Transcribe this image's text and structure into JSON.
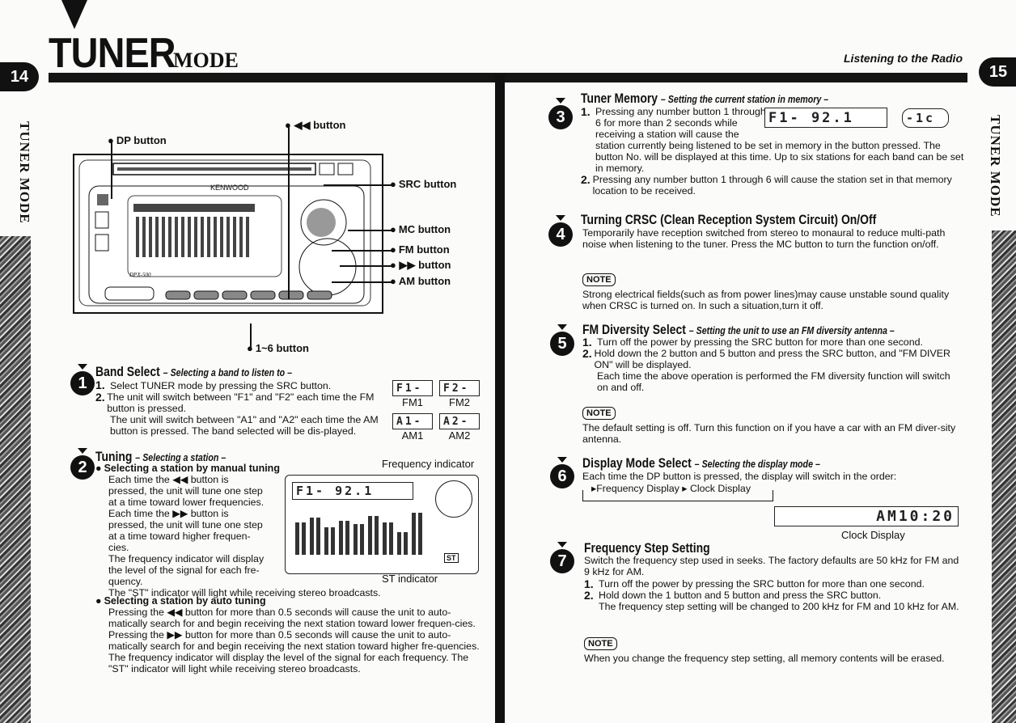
{
  "header": {
    "title_main": "TUNER",
    "title_sub": "MODE",
    "left_page": "14",
    "right_page": "15",
    "section": "Listening to the Radio",
    "side_label": "TUNER MODE"
  },
  "diagram": {
    "brand": "KENWOOD",
    "model": "DPX-500",
    "labels": {
      "dp": "DP button",
      "prev": "button",
      "src": "SRC button",
      "mc": "MC button",
      "fm": "FM button",
      "next": "button",
      "am": "AM button",
      "presets": "1~6 button"
    }
  },
  "sections": [
    {
      "num": "1",
      "title": "Band Select",
      "subtitle": "– Selecting a band to listen to –",
      "steps": [
        "Select TUNER mode by pressing the SRC button.",
        "The unit will switch between \"F1\" and \"F2\" each time the FM button is pressed."
      ],
      "extra": [
        "The unit will switch between \"A1\" and \"A2\" each time the AM button is pressed. The band selected will be dis-played."
      ],
      "displays": [
        {
          "lcd": "F1-",
          "cap": "FM1"
        },
        {
          "lcd": "F2-",
          "cap": "FM2"
        },
        {
          "lcd": "A1-",
          "cap": "AM1"
        },
        {
          "lcd": "A2-",
          "cap": "AM2"
        }
      ]
    },
    {
      "num": "2",
      "title": "Tuning",
      "subtitle": "– Selecting a station –",
      "manual_title": "Selecting a station by manual tuning",
      "manual": [
        "Each time the ◀◀ button is",
        "pressed, the unit will tune one step",
        "at a time toward lower frequencies.",
        "Each time the ▶▶ button is",
        "pressed, the unit will tune one step",
        "at a time toward higher frequen-",
        "cies.",
        "The frequency indicator will display",
        "the level of the signal for each fre-",
        "quency."
      ],
      "manual_last": "The \"ST\" indicator will light while receiving stereo broadcasts.",
      "freq_indicator": "Frequency indicator",
      "st_indicator": "ST indicator",
      "lcd": "F1- 92.1",
      "st": "ST",
      "auto_title": "Selecting a station by auto tuning",
      "auto": "Pressing the ◀◀ button for more than 0.5 seconds will cause the unit to auto-matically search for and begin receiving the next station toward lower frequen-cies. Pressing the ▶▶ button for more than 0.5 seconds will cause the unit to auto-matically search for and begin receiving the next station toward higher fre-quencies. The frequency indicator will display the level of the signal for each frequency. The \"ST\" indicator will light while receiving stereo broadcasts."
    },
    {
      "num": "3",
      "title": "Tuner Memory",
      "subtitle": "– Setting the current station in memory –",
      "step1": "Pressing any number button 1 through 6 for more than 2 seconds while receiving a station will cause the station currently being listened to be set in memory in the button pressed. The button No. will be displayed at this time. Up to six stations for each band can be set in memory.",
      "step2": "Pressing any number button 1 through 6 will cause the station set in that memory location to be received.",
      "lcd": "F1- 92.1",
      "lcd_preset": "-1c"
    },
    {
      "num": "4",
      "title": "Turning CRSC (Clean Reception System Circuit) On/Off",
      "body": "Temporarily have reception switched from stereo to monaural to reduce multi-path noise when listening to the tuner. Press the MC button to turn the function on/off.",
      "note_label": "NOTE",
      "note": "Strong electrical fields(such as from power lines)may cause unstable sound quality when CRSC is turned on. In such a situation,turn it off."
    },
    {
      "num": "5",
      "title": "FM Diversity Select",
      "subtitle": "– Setting the unit to use an FM diversity antenna –",
      "step1": "Turn off the power by pressing the SRC button for more than one second.",
      "step2": "Hold down the 2 button and 5 button and press the SRC button, and \"FM DIVER ON\" will be displayed.",
      "step2b": "Each time the above operation is performed the FM diversity function will switch on and off.",
      "note_label": "NOTE",
      "note": "The default setting is off. Turn this function on if you have a car with an FM diver-sity antenna."
    },
    {
      "num": "6",
      "title": "Display Mode Select",
      "subtitle": "– Selecting the display mode –",
      "body": "Each time the DP button is pressed, the display will switch in the order:",
      "cycle": [
        "Frequency Display",
        "Clock Display"
      ],
      "lcd": "AM10:20",
      "lcd_caption": "Clock Display"
    },
    {
      "num": "7",
      "title": "Frequency Step Setting",
      "body": "Switch the frequency step used in seeks. The factory defaults are 50 kHz for FM and 9 kHz for AM.",
      "step1": "Turn off the power by pressing the SRC button for more than one second.",
      "step2": "Hold down the 1 button and 5 button and press the SRC button.",
      "step2b": "The frequency step setting will be changed to 200 kHz for FM and 10 kHz for AM.",
      "note_label": "NOTE",
      "note": "When you change the frequency step setting, all memory contents will be erased."
    }
  ]
}
